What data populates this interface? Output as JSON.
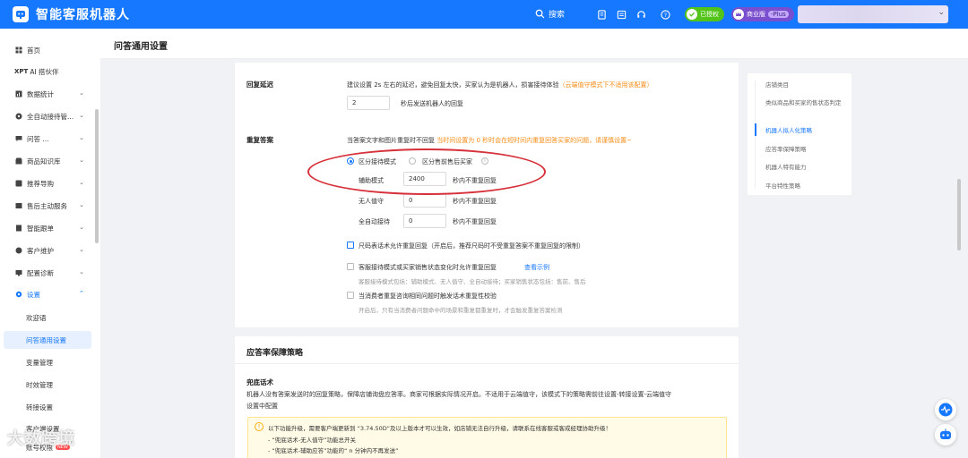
{
  "topbar": {
    "app_title": "智能客服机器人",
    "search_label": "搜索",
    "auth_label": "已授权",
    "plan_label": "商业版",
    "plan_tag": "-Plus",
    "colors": {
      "brand": "#1677ff"
    }
  },
  "sidebar": {
    "home": "首页",
    "xpt_brand": "XPT",
    "xpt_label": "AI 搭伙伴",
    "items": [
      {
        "label": "数据统计",
        "icon": "chart-icon"
      },
      {
        "label": "全自动接待管...",
        "icon": "robot-icon"
      },
      {
        "label": "问答 ...",
        "icon": "chat-icon"
      },
      {
        "label": "商品知识库",
        "icon": "shop-icon"
      },
      {
        "label": "推荐导购",
        "icon": "guide-icon"
      },
      {
        "label": "售后主动服务",
        "icon": "service-icon"
      },
      {
        "label": "智能跟单",
        "icon": "order-icon"
      },
      {
        "label": "客户维护",
        "icon": "customer-icon"
      },
      {
        "label": "配置诊断",
        "icon": "diagnose-icon"
      }
    ],
    "settings": "设置",
    "sub_items": [
      "欢迎语",
      "问答通用设置",
      "变量管理",
      "时效管理",
      "转接设置",
      "客户端设置",
      "账号权限"
    ],
    "new_badge": "NEW"
  },
  "page": {
    "title": "问答通用设置"
  },
  "reply_delay": {
    "label": "回复延迟",
    "desc": "建议设置 2s 左右的延迟，避免回复太快，买家认为是机器人，损害接待体验",
    "desc_warn": "（云端值守模式下不适用该配置）",
    "value": "2",
    "suffix": "秒后发送机器人的回复"
  },
  "repeat_answer": {
    "label": "重复答案",
    "desc": "当答案文字和图片重复时不回复",
    "desc_warn": "当时间设置为 0 秒时会在短时间内重复回答买家的问题，请谨慎设置~",
    "mode_a": "区分接待模式",
    "mode_b": "区分售前售后买家",
    "rows": [
      {
        "label": "辅助模式",
        "value": "2400",
        "suffix": "秒内不重复回复"
      },
      {
        "label": "无人值守",
        "value": "0",
        "suffix": "秒内不重复回复"
      },
      {
        "label": "全自动接待",
        "value": "0",
        "suffix": "秒内不重复回复"
      }
    ],
    "check1": "尺码表话术允许重复回复（开启后，推荐尺码时不受重复答案不重复回复的限制）",
    "check2": "客服接待模式或买家销售状态变化时允许重复回复",
    "check2_link": "查看示例",
    "check2_hint": "客服接待模式包括：辅助模式、无人值守、全自动接待；买家销售状态包括：售前、售后",
    "check3": "当消费者重复咨询相同问题时触发话术重复性校验",
    "check3_hint": "开启后，只有当消费者问题命中的场景和重复都重复时，才会触发重复答案检测"
  },
  "response_rate": {
    "title": "应答率保障策略",
    "fallback_label": "兜底话术",
    "fallback_desc1": "机器人没有答案发送时的回复策略，保障店铺询盘应答率。商家可根据实际情况开启。不适用于云端值守，该模式下的策略需前往设置-转接设置-云端值守",
    "fallback_desc2": "设置中配置",
    "notice_line1": "以下功能升级，需要客户端更新到 “3.74.50D”及以上版本才可以生效，如店铺无法自行升级，请联系在线客服或客成经理协助升级！",
    "notice_line2": "- “兜底话术-无人值守”功能总开关",
    "notice_line3": "- “兜底话术-辅助应答”功能的“ n 分钟内不再发送”"
  },
  "anchor_nav": [
    "店铺类目",
    "类似商品和买家的售状态判定",
    "机器人拟人化策略",
    "应答率保障策略",
    "机器人特有能力",
    "平台特性策略"
  ],
  "watermark": "大数跨境"
}
